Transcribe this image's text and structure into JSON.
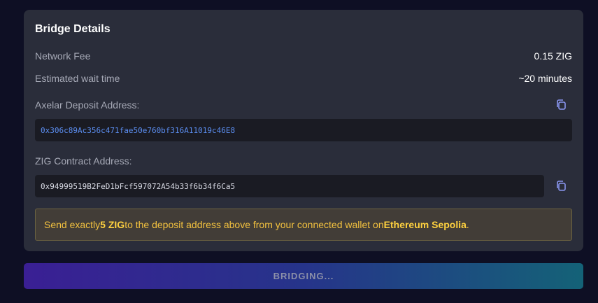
{
  "card": {
    "title": "Bridge Details",
    "network_fee": {
      "label": "Network Fee",
      "value": "0.15 ZIG"
    },
    "wait_time": {
      "label": "Estimated wait time",
      "value": "~20 minutes"
    },
    "axelar": {
      "label": "Axelar Deposit Address:",
      "address": "0x306c89Ac356c471fae50e760bf316A11019c46E8",
      "copy_icon": "copy-icon"
    },
    "zig_contract": {
      "label": "ZIG Contract Address:",
      "address": "0x94999519B2FeD1bFcf597072A54b33f6b34f6Ca5",
      "copy_icon": "copy-icon"
    },
    "notice": {
      "prefix": "Send exactly ",
      "amount": "5 ZIG",
      "middle": " to the deposit address above from your connected wallet on ",
      "network": "Ethereum Sepolia",
      "suffix": "."
    }
  },
  "action_button": {
    "label": "BRIDGING..."
  },
  "colors": {
    "accent_link": "#5b8def",
    "notice_text": "#f3c23f",
    "icon": "#8a96f0"
  }
}
